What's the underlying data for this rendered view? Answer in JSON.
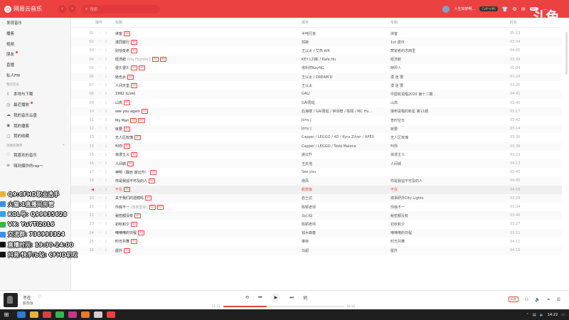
{
  "app": {
    "title": "网易云音乐",
    "search_placeholder": "搜索",
    "username": "人生如梦啊…",
    "vip_label": "CVIP·VIP6",
    "msg_count": "99+"
  },
  "watermark": "斗鱼",
  "sidebar": {
    "items": [
      {
        "label": "发现音乐",
        "icon": "",
        "dot": false,
        "small": false
      },
      {
        "label": "播客",
        "icon": "",
        "dot": false,
        "small": false
      },
      {
        "label": "视频",
        "icon": "",
        "dot": false,
        "small": false
      },
      {
        "label": "朋友",
        "icon": "",
        "dot": true,
        "small": false
      },
      {
        "label": "直播",
        "icon": "",
        "dot": false,
        "small": false
      },
      {
        "label": "私人FM",
        "icon": "",
        "dot": false,
        "small": false
      },
      {
        "label": "我的音乐",
        "icon": "",
        "dot": false,
        "small": true
      },
      {
        "label": "本地与下载",
        "icon": "local-download-icon",
        "dot": false,
        "small": false
      },
      {
        "label": "最近播放",
        "icon": "recent-play-icon",
        "dot": true,
        "small": false
      },
      {
        "label": "我的音乐云盘",
        "icon": "cloud-icon",
        "dot": false,
        "small": false
      },
      {
        "label": "我的播客",
        "icon": "podcast-icon",
        "dot": false,
        "small": false
      },
      {
        "label": "我的收藏",
        "icon": "collection-icon",
        "dot": false,
        "small": false
      },
      {
        "label": "创建的歌单",
        "icon": "",
        "dot": false,
        "small": true,
        "plus": true
      },
      {
        "label": "我喜欢的音乐",
        "icon": "heart-icon",
        "dot": false,
        "small": false
      },
      {
        "label": "嗨到爆炸的rap～",
        "icon": "playlist-icon",
        "dot": false,
        "small": false
      }
    ]
  },
  "list": {
    "headers": {
      "op": "操作",
      "title": "标题",
      "artist": "歌手",
      "album": "专辑",
      "time": "时长"
    },
    "rows": [
      {
        "idx": "01",
        "title": "侠客",
        "sub": "",
        "tags": [
          "SQ"
        ],
        "artist": "半吨兄弟",
        "album": "侠客",
        "time": "05:13"
      },
      {
        "idx": "02",
        "title": "漫同窗行",
        "sub": "",
        "tags": [
          "SQ"
        ],
        "artist": "郭菽",
        "album": "1st 漫印",
        "time": "03:34"
      },
      {
        "idx": "03",
        "title": "别怕变老",
        "sub": "",
        "tags": [
          "SQ"
        ],
        "artist": "王以太 / 艾热 AIR",
        "album": "寒窗者的念西里",
        "time": "04:05"
      },
      {
        "idx": "04",
        "title": "经济舱",
        "sub": " (Via Flightin')",
        "tags": [
          "SQ",
          "MV"
        ],
        "artist": "KEY L刘新 / Kafe.Hu",
        "album": "经济舱",
        "time": "03:39"
      },
      {
        "idx": "05",
        "title": "很久很久",
        "sub": "",
        "tags": [
          "SQ",
          "MV"
        ],
        "artist": "塔利然KayNG",
        "album": "時羿人",
        "time": "05:04"
      },
      {
        "idx": "06",
        "title": "她也太",
        "sub": "",
        "tags": [
          "SQ"
        ],
        "artist": "王以太 / DREAM D",
        "album": "漠 迷 要",
        "time": "03:24"
      },
      {
        "idx": "07",
        "title": "人间天堂",
        "sub": "",
        "tags": [
          "SQ"
        ],
        "artist": "王以太",
        "album": "漠 迷 要",
        "time": "03:25"
      },
      {
        "idx": "08",
        "title": "1992 (Live)",
        "sub": "",
        "tags": [],
        "artist": "GALI",
        "album": "中国有说唱2020 第十二期",
        "time": "04:41"
      },
      {
        "idx": "09",
        "title": "山高",
        "sub": "",
        "tags": [
          "SQ"
        ],
        "artist": "GAI周延",
        "album": "山高",
        "time": "03:40"
      },
      {
        "idx": "10",
        "title": "see you again",
        "sub": "",
        "tags": [
          "SQ"
        ],
        "artist": "后海楼 / GAI周延 / 钟添楷 / 陈顾 / MC Hu...",
        "album": "接到说唱的新星 第11期",
        "time": "03:17"
      },
      {
        "idx": "11",
        "title": "My Man",
        "sub": "",
        "tags": [
          "SQ",
          "MV"
        ],
        "artist": "Jony J",
        "album": "查时空日",
        "time": "03:42"
      },
      {
        "idx": "12",
        "title": "就要",
        "sub": "",
        "tags": [
          "SQ"
        ],
        "artist": "Jony J",
        "album": "就要",
        "time": "03:14"
      },
      {
        "idx": "13",
        "title": "无人区玫瑰",
        "sub": "",
        "tags": [
          "SQ"
        ],
        "artist": "Capper / LEGGO / 4D / Kyra Zilver / APEX",
        "album": "无人区玫瑰",
        "time": "03:36"
      },
      {
        "idx": "14",
        "title": "叫你",
        "sub": "",
        "tags": [
          "SQ"
        ],
        "artist": "Capper / LEGGO / Todd Malone",
        "album": "叫你",
        "time": "03:39"
      },
      {
        "idx": "15",
        "title": "浪漫主义",
        "sub": "",
        "tags": [
          "SQ"
        ],
        "artist": "謝云升",
        "album": "浪漫主义",
        "time": "03:23"
      },
      {
        "idx": "16",
        "title": "人间城",
        "sub": "",
        "tags": [
          "SQ"
        ],
        "artist": "王天浩",
        "album": "人间城",
        "time": "04:13"
      },
      {
        "idx": "17",
        "title": "神明（翻自 謝云升）",
        "sub": "",
        "tags": [
          "SQ"
        ],
        "artist": "See you",
        "album": "",
        "time": "03:45"
      },
      {
        "idx": "18",
        "title": "你是我遥不可及的人",
        "sub": "",
        "tags": [
          "SQ"
        ],
        "artist": "南风",
        "album": "你是我遥不可及的人",
        "time": "04:45"
      },
      {
        "idx": "19",
        "title": "不在",
        "sub": "",
        "tags": [
          "SQ"
        ],
        "artist": "颜俞饭",
        "album": "不在",
        "time": "04:16",
        "playing": true
      },
      {
        "idx": "20",
        "title": "关于我们的遗憾吗",
        "sub": "",
        "tags": [
          "SQ"
        ],
        "artist": "岩士达",
        "album": "城事研外City Lights",
        "time": "03:29"
      },
      {
        "idx": "21",
        "title": "你我不一",
        "sub": " (慢着重版)",
        "tags": [
          "SQ",
          "MV"
        ],
        "artist": "陈颖老师",
        "album": "你我不一",
        "time": "03:34"
      },
      {
        "idx": "22",
        "title": "秘密都没有",
        "sub": "",
        "tags": [
          "SQ"
        ],
        "artist": "马心仙",
        "album": "秘密都没有",
        "time": "03:46"
      },
      {
        "idx": "23",
        "title": "初秋和夕",
        "sub": "",
        "tags": [
          "SQ"
        ],
        "artist": "陈颖老师",
        "album": "初秋和夕",
        "time": "03:27"
      },
      {
        "idx": "24",
        "title": "嘀嘀嘀的日程",
        "sub": "",
        "tags": [
          "SQ"
        ],
        "artist": "钱木森春",
        "album": "嘀嘀嘀的日程",
        "time": "03:51"
      },
      {
        "idx": "25",
        "title": "时光共舞",
        "sub": "",
        "tags": [
          "SQ"
        ],
        "artist": "推特",
        "album": "时光共舞",
        "time": "04:11"
      },
      {
        "idx": "26",
        "title": "屋外",
        "sub": "",
        "tags": [
          "SQ"
        ],
        "artist": "马超",
        "album": "屋外",
        "time": "04:15"
      }
    ]
  },
  "overlay": {
    "lines": [
      {
        "text": "Q9:CFHD职业选手",
        "color": "#e8b33a"
      },
      {
        "text": "火猫:1直播间房管",
        "color": "#3a8fe8"
      },
      {
        "text": "KOL号: Q99935628",
        "color": "#36a0e8"
      },
      {
        "text": "VX: YuYTi2016",
        "color": "#2fb84f"
      },
      {
        "text": "交流群: 736993324",
        "color": "#3a8fe8"
      },
      {
        "text": "直播时间: 19:30-24:00",
        "color": "#111111"
      },
      {
        "text": "抖音/快手/b站: CFHD初叹",
        "color": "#111111"
      }
    ]
  },
  "player": {
    "song": "不在",
    "artist": "颜俞饭",
    "time_current": "01:33",
    "time_total": "04:16",
    "progress": 0.36,
    "quality": "标准",
    "controls": {
      "loop": "⟲",
      "prev": "⏮",
      "play": "▶",
      "next": "⏭",
      "lyric": "词"
    }
  },
  "taskbar": {
    "clock": "14:22",
    "apps": [
      "#2d7cd6",
      "#e8b33a",
      "#d64040",
      "#2fb84f",
      "#c23a8a",
      "#e87a2f",
      "#cfcfcf",
      "#ec4141"
    ]
  },
  "colors": {
    "brand": "#ec4141"
  }
}
